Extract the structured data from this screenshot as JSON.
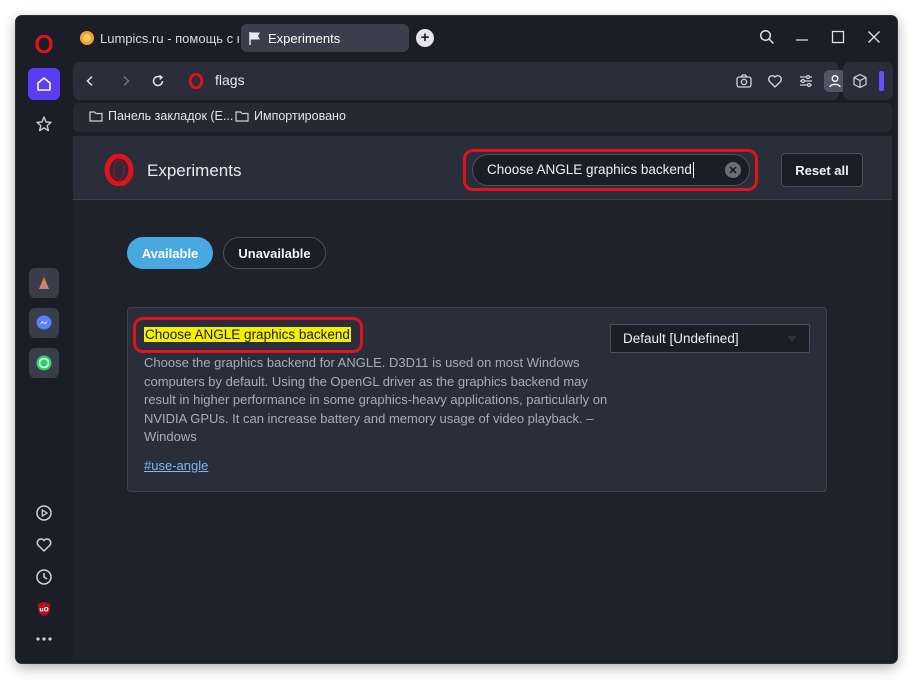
{
  "tabs": [
    {
      "label": "Lumpics.ru - помощь с ко"
    },
    {
      "label": "Experiments"
    }
  ],
  "toolbar": {
    "url": "flags"
  },
  "bookmarks": [
    {
      "label": "Панель закладок (E..."
    },
    {
      "label": "Импортировано"
    }
  ],
  "page": {
    "title": "Experiments",
    "search_value": "Choose ANGLE graphics backend",
    "reset_label": "Reset all",
    "filters": {
      "available": "Available",
      "unavailable": "Unavailable"
    }
  },
  "experiment": {
    "name": "Choose ANGLE graphics backend",
    "description": "Choose the graphics backend for ANGLE. D3D11 is used on most Windows computers by default. Using the OpenGL driver as the graphics backend may result in higher performance in some graphics-heavy applications, particularly on NVIDIA GPUs. It can increase battery and memory usage of video playback. – Windows",
    "link": "#use-angle",
    "selected_option": "Default [Undefined]"
  },
  "colors": {
    "accent": "#5b3df6",
    "highlight_border": "#e0131b",
    "search_highlight": "#f5f000",
    "available_pill": "#4aa8e0",
    "opera_red": "#e0131b"
  },
  "sidebar_icons": [
    "opera-logo-icon",
    "home-icon",
    "bookmarks-star-icon",
    "aria-icon",
    "messenger-icon",
    "whatsapp-icon",
    "player-icon",
    "heart-icon",
    "history-clock-icon",
    "ublock-icon",
    "more-dots-icon"
  ]
}
